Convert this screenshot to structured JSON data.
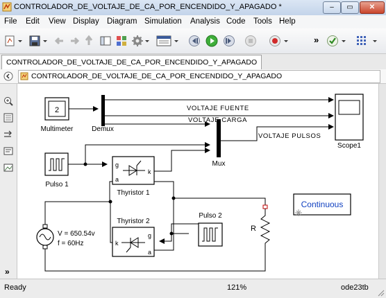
{
  "window": {
    "title": "CONTROLADOR_DE_VOLTAJE_DE_CA_POR_ENCENDIDO_Y_APAGADO *"
  },
  "menu": [
    "File",
    "Edit",
    "View",
    "Display",
    "Diagram",
    "Simulation",
    "Analysis",
    "Code",
    "Tools",
    "Help"
  ],
  "tab": {
    "label": "CONTROLADOR_DE_VOLTAJE_DE_CA_POR_ENCENDIDO_Y_APAGADO"
  },
  "breadcrumb": {
    "label": "CONTROLADOR_DE_VOLTAJE_DE_CA_POR_ENCENDIDO_Y_APAGADO"
  },
  "toolbar": {
    "overflow_label": "»"
  },
  "diagram": {
    "multimeter": {
      "value": "2",
      "label": "Multimeter"
    },
    "demux": {
      "label": "Demux"
    },
    "mux": {
      "label": "Mux"
    },
    "scope": {
      "label": "Scope1"
    },
    "pulse1": {
      "label": "Pulso 1"
    },
    "pulse2": {
      "label": "Pulso 2"
    },
    "thyristor1": {
      "label": "Thyristor 1",
      "port_g": "g",
      "port_a": "a",
      "port_k": "k"
    },
    "thyristor2": {
      "label": "Thyristor 2",
      "port_g": "g",
      "port_a": "a",
      "port_k": "k"
    },
    "resistor": {
      "label": "R"
    },
    "source": {
      "voltage": "V = 650.54v",
      "frequency": "f = 60Hz"
    },
    "signals": {
      "source": "VOLTAJE FUENTE",
      "load": "VOLTAJE CARGA",
      "pulses": "VOLTAJE PULSOS"
    },
    "powergui": {
      "label": "Continuous"
    }
  },
  "status": {
    "left": "Ready",
    "zoom": "121%",
    "solver": "ode23tb"
  }
}
